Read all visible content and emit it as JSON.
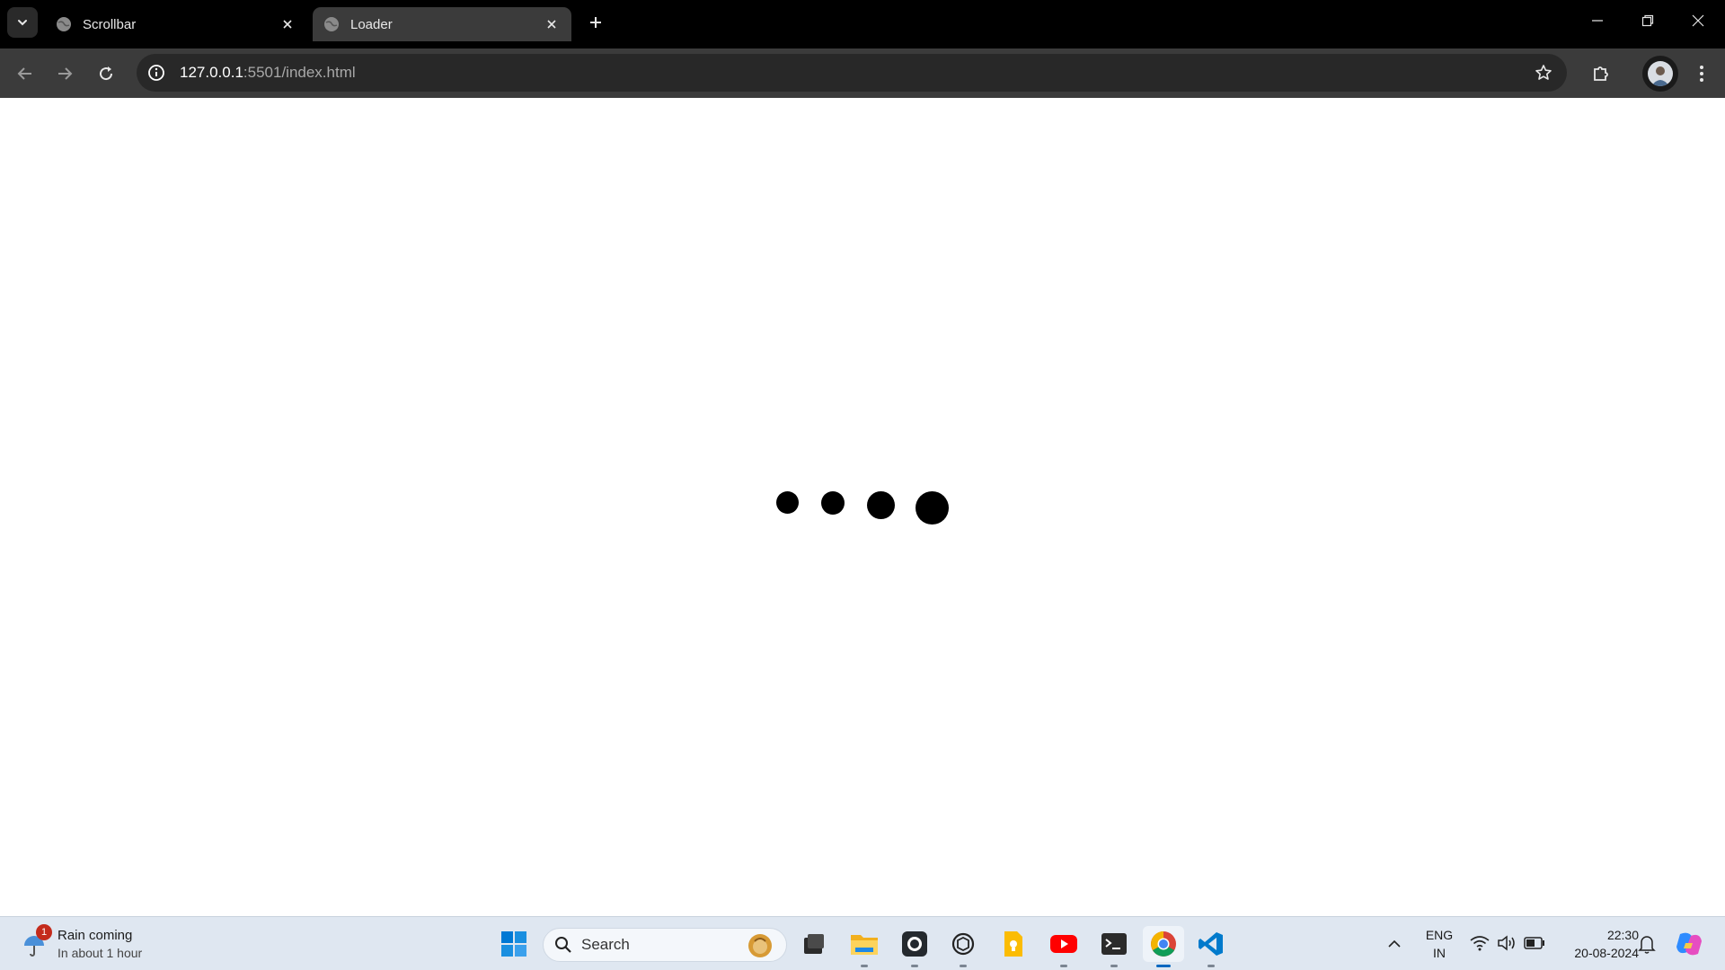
{
  "browser": {
    "tabs": [
      {
        "title": "Scrollbar",
        "active": false
      },
      {
        "title": "Loader",
        "active": true
      }
    ],
    "address_bar": {
      "host": "127.0.0.1",
      "rest": ":5501/index.html"
    }
  },
  "page": {
    "loader_dots_count": 4
  },
  "taskbar": {
    "weather": {
      "badge": "1",
      "line1": "Rain coming",
      "line2": "In about 1 hour"
    },
    "search": {
      "label": "Search"
    },
    "apps": [
      "task-view",
      "file-explorer",
      "github-desktop",
      "chatgpt",
      "google-keep",
      "youtube",
      "terminal",
      "chrome",
      "vscode"
    ],
    "tray": {
      "lang1": "ENG",
      "lang2": "IN",
      "time": "22:30",
      "date": "20-08-2024"
    }
  },
  "colors": {
    "accent": "#0067c0",
    "youtube": "#ff0000",
    "vscode": "#007acc"
  }
}
